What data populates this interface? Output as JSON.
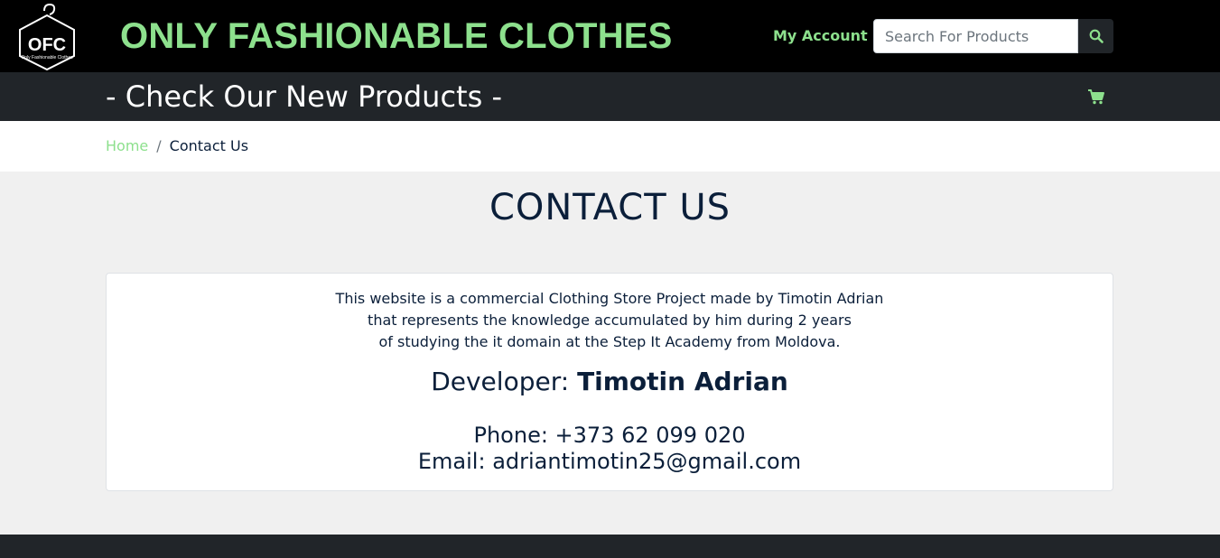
{
  "header": {
    "logo_text": "OFC",
    "logo_subtext": "Only Fashionable Clothes",
    "brand": "ONLY FASHIONABLE CLOTHES",
    "my_account": "My Account",
    "search_placeholder": "Search For Products",
    "search_icon": "search-icon",
    "accent_color": "#8de08d"
  },
  "subbar": {
    "title": "- Check Our New Products -",
    "cart_icon": "shopping-cart-icon"
  },
  "breadcrumb": {
    "home": "Home",
    "separator": "/",
    "current": "Contact Us"
  },
  "page": {
    "title": "CONTACT US"
  },
  "contact": {
    "description_lines": [
      "This website is a commercial Clothing Store Project made by Timotin Adrian",
      "that represents the knowledge accumulated by him during 2 years",
      "of studying the it domain at the Step It Academy from Moldova."
    ],
    "developer_label": "Developer: ",
    "developer_name": "Timotin Adrian",
    "phone": "Phone: +373 62 099 020",
    "email": "Email: adriantimotin25@gmail.com"
  }
}
